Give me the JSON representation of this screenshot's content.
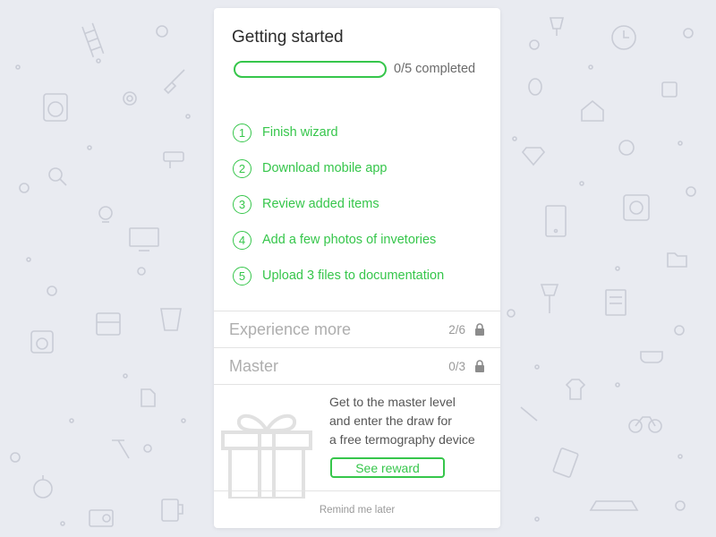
{
  "card": {
    "title": "Getting started",
    "progress": {
      "completed": 0,
      "total": 5,
      "text": "0/5 completed"
    },
    "steps": [
      {
        "number": "1",
        "label": "Finish wizard"
      },
      {
        "number": "2",
        "label": "Download mobile app"
      },
      {
        "number": "3",
        "label": "Review added items"
      },
      {
        "number": "4",
        "label": "Add a few photos of invetories"
      },
      {
        "number": "5",
        "label": "Upload 3 files to documentation"
      }
    ],
    "levels": [
      {
        "name": "Experience more",
        "count": "2/6",
        "icon": "lock-icon"
      },
      {
        "name": "Master",
        "count": "0/3",
        "icon": "lock-icon"
      }
    ],
    "reward": {
      "lines": [
        "Get to the master level",
        "and enter the draw for",
        "a free termography device"
      ],
      "button_label": "See reward",
      "icon": "gift-icon"
    },
    "remind_label": "Remind me later"
  },
  "colors": {
    "accent": "#36c64b",
    "background": "#e9ebf1",
    "pattern": "#c9ccd6"
  }
}
